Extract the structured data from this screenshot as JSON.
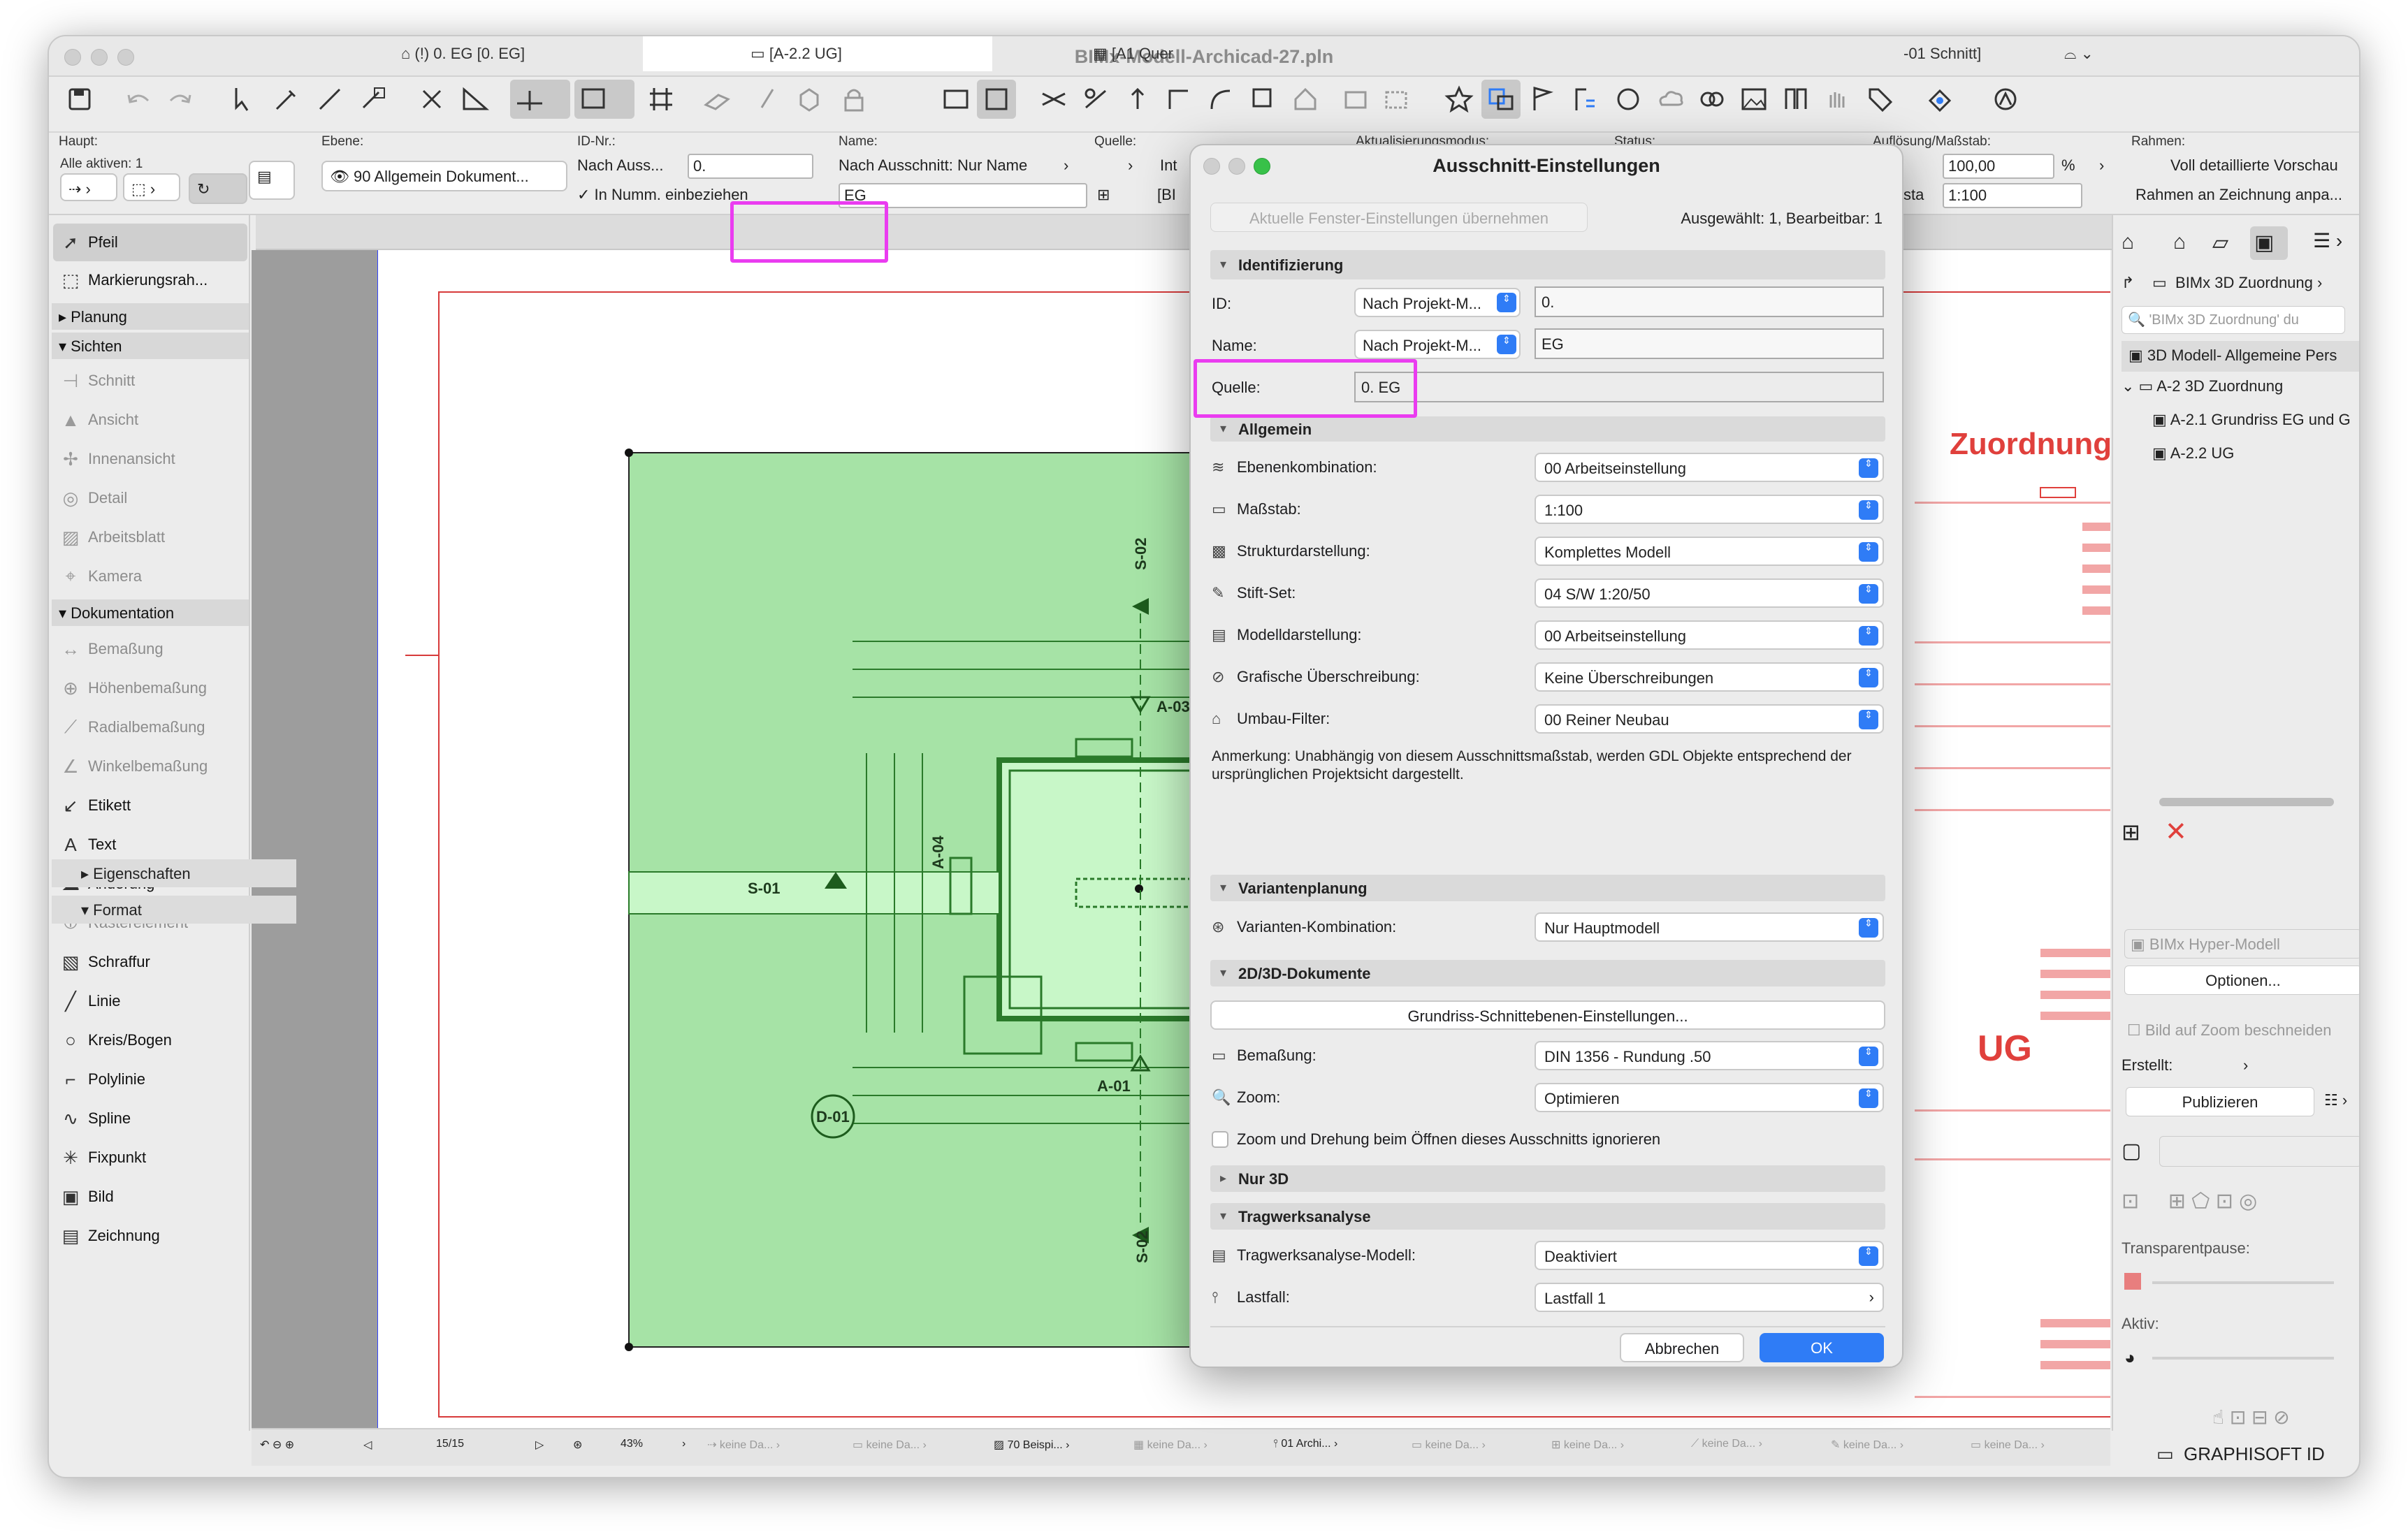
{
  "window": {
    "title": "BIMx-Modell-Archicad-27.pln"
  },
  "infobox": {
    "haupt_label": "Haupt:",
    "haupt_value": "Alle aktiven: 1",
    "ebene_label": "Ebene:",
    "ebene_value": "90 Allgemein Dokument...",
    "id_label": "ID-Nr.:",
    "id_mode": "Nach Auss...",
    "id_value": "0.",
    "in_numm": "In Numm. einbeziehen",
    "name_label": "Name:",
    "name_mode": "Nach Ausschnitt: Nur Name",
    "name_value": "EG",
    "quelle_label": "Quelle:",
    "quelle_value": "Int",
    "quelle_value2": "[BI",
    "aktual_label": "Aktualisierungsmodus:",
    "status_label": "Status:",
    "aufl_label": "Auflösung/Maßstab:",
    "aufl_value": "100,00",
    "aufl_unit": "%",
    "sta": "sta",
    "aufl_scale": "1:100",
    "rahmen_label": "Rahmen:",
    "rahmen_value1": "Voll detaillierte Vorschau",
    "rahmen_value2": "Rahmen an Zeichnung anpa..."
  },
  "tabs": [
    {
      "label": "(!) 0. EG [0. EG]"
    },
    {
      "label": "[A-2.2 UG]"
    },
    {
      "label": "[A1 Quer"
    },
    {
      "label": "-01 Schnitt]"
    }
  ],
  "toolbox": {
    "items": [
      {
        "label": "Pfeil"
      },
      {
        "label": "Markierungsrah..."
      },
      {
        "label": "Planung"
      },
      {
        "label": "Sichten"
      },
      {
        "label": "Schnitt"
      },
      {
        "label": "Ansicht"
      },
      {
        "label": "Innenansicht"
      },
      {
        "label": "Detail"
      },
      {
        "label": "Arbeitsblatt"
      },
      {
        "label": "Kamera"
      },
      {
        "label": "Dokumentation"
      },
      {
        "label": "Bemaßung"
      },
      {
        "label": "Höhenbemaßung"
      },
      {
        "label": "Radialbemaßung"
      },
      {
        "label": "Winkelbemaßung"
      },
      {
        "label": "Etikett"
      },
      {
        "label": "Text"
      },
      {
        "label": "Änderung"
      },
      {
        "label": "Rasterelement"
      },
      {
        "label": "Schraffur"
      },
      {
        "label": "Linie"
      },
      {
        "label": "Kreis/Bogen"
      },
      {
        "label": "Polylinie"
      },
      {
        "label": "Spline"
      },
      {
        "label": "Fixpunkt"
      },
      {
        "label": "Bild"
      },
      {
        "label": "Zeichnung"
      }
    ]
  },
  "drawing": {
    "labels": [
      "S-02",
      "A-03",
      "S-01",
      "A-04",
      "D-01",
      "A-01",
      "S-02"
    ],
    "sheet_title1": "Zuordnung",
    "sheet_title2": "UG"
  },
  "dialog": {
    "title": "Ausschnitt-Einstellungen",
    "apply_button": "Aktuelle Fenster-Einstellungen übernehmen",
    "selected_info": "Ausgewählt: 1, Bearbeitbar: 1",
    "sec_identify": "Identifizierung",
    "id_label": "ID:",
    "id_mode": "Nach Projekt-M...",
    "id_value": "0.",
    "name_label": "Name:",
    "name_mode": "Nach Projekt-M...",
    "name_value": "EG",
    "quelle_label": "Quelle:",
    "quelle_value": "0. EG",
    "sec_allgemein": "Allgemein",
    "rows": [
      {
        "label": "Ebenenkombination:",
        "value": "00 Arbeitseinstellung"
      },
      {
        "label": "Maßstab:",
        "value": "1:100"
      },
      {
        "label": "Strukturdarstellung:",
        "value": "Komplettes Modell"
      },
      {
        "label": "Stift-Set:",
        "value": "04 S/W 1:20/50"
      },
      {
        "label": "Modelldarstellung:",
        "value": "00 Arbeitseinstellung"
      },
      {
        "label": "Grafische Überschreibung:",
        "value": "Keine Überschreibungen"
      },
      {
        "label": "Umbau-Filter:",
        "value": "00 Reiner Neubau"
      }
    ],
    "note": "Anmerkung: Unabhängig von diesem Ausschnittsmaßstab, werden GDL Objekte entsprechend der ursprünglichen Projektsicht dargestellt.",
    "sec_variant": "Variantenplanung",
    "variant_label": "Varianten-Kombination:",
    "variant_value": "Nur Hauptmodell",
    "sec_2d3d": "2D/3D-Dokumente",
    "grundriss_button": "Grundriss-Schnittebenen-Einstellungen...",
    "bem_label": "Bemaßung:",
    "bem_value": "DIN 1356 - Rundung .50",
    "zoom_label": "Zoom:",
    "zoom_value": "Optimieren",
    "zoom_check": "Zoom und Drehung beim Öffnen dieses Ausschnitts ignorieren",
    "sec_nur3d": "Nur 3D",
    "sec_trag": "Tragwerksanalyse",
    "trag_label": "Tragwerksanalyse-Modell:",
    "trag_value": "Deaktiviert",
    "last_label": "Lastfall:",
    "last_value": "Lastfall 1",
    "cancel": "Abbrechen",
    "ok": "OK"
  },
  "right_panel": {
    "nav_title": "BIMx 3D Zuordnung",
    "search_placeholder": "'BIMx 3D Zuordnung' du",
    "tree": [
      {
        "label": "3D Modell- Allgemeine Pers"
      },
      {
        "label": "A-2 3D Zuordnung"
      },
      {
        "label": "A-2.1 Grundriss EG und G"
      },
      {
        "label": "A-2.2 UG"
      }
    ],
    "eigenschaften": "Eigenschaften",
    "format": "Format",
    "format_value": "BIMx Hyper-Modell",
    "optionen": "Optionen...",
    "bild_zoom": "Bild auf Zoom beschneiden",
    "erstellt": "Erstellt:",
    "publizieren": "Publizieren",
    "transparentpause": "Transparentpause:",
    "aktiv": "Aktiv:",
    "graphisoft": "GRAPHISOFT ID"
  },
  "statusbar": {
    "page": "15/15",
    "zoom": "43%",
    "items": [
      "keine Da...",
      "keine Da...",
      "70 Beispi...",
      "keine Da...",
      "01 Archi...",
      "keine Da...",
      "keine Da...",
      "keine Da...",
      "keine Da...",
      "keine Da..."
    ]
  },
  "colors": {
    "accent": "#2f7cf6",
    "highlight": "#ea3cf0",
    "green": "#a6e3a6",
    "red": "#e0403c"
  }
}
